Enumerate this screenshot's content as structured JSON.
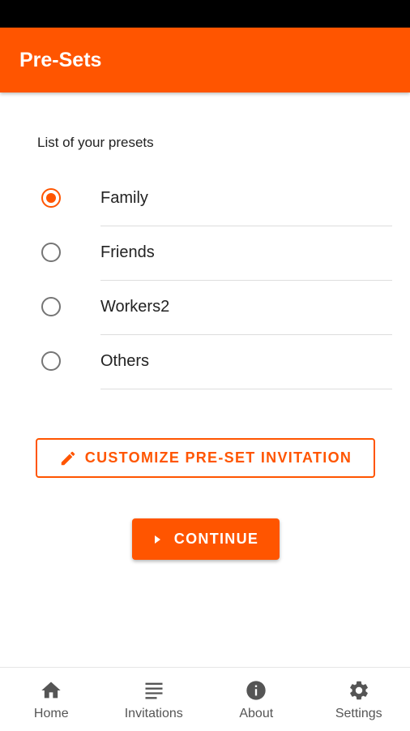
{
  "app_bar": {
    "title": "Pre-Sets"
  },
  "presets": {
    "heading": "List of your presets",
    "items": [
      {
        "label": "Family",
        "selected": true
      },
      {
        "label": "Friends",
        "selected": false
      },
      {
        "label": "Workers2",
        "selected": false
      },
      {
        "label": "Others",
        "selected": false
      }
    ]
  },
  "actions": {
    "customize_label": "CUSTOMIZE PRE-SET INVITATION",
    "customize_icon": "pencil-icon",
    "continue_label": "CONTINUE",
    "continue_icon": "play-arrow-icon"
  },
  "bottom_nav": {
    "items": [
      {
        "label": "Home",
        "icon": "home-icon"
      },
      {
        "label": "Invitations",
        "icon": "list-icon"
      },
      {
        "label": "About",
        "icon": "info-icon"
      },
      {
        "label": "Settings",
        "icon": "gear-icon"
      }
    ]
  },
  "colors": {
    "accent": "#ff5500",
    "status_bar": "#000000",
    "nav_icon": "#555555"
  }
}
